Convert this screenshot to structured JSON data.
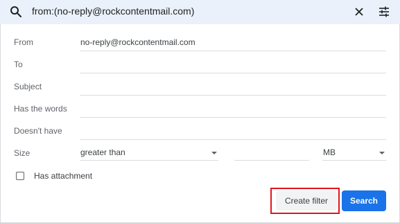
{
  "search": {
    "query": "from:(no-reply@rockcontentmail.com)"
  },
  "icons": {
    "search": "search-icon",
    "close": "close-icon",
    "options": "tune-icon"
  },
  "fields": [
    {
      "label": "From",
      "value": "no-reply@rockcontentmail.com"
    },
    {
      "label": "To",
      "value": ""
    },
    {
      "label": "Subject",
      "value": ""
    },
    {
      "label": "Has the words",
      "value": ""
    },
    {
      "label": "Doesn't have",
      "value": ""
    }
  ],
  "size": {
    "label": "Size",
    "comparator": "greater than",
    "amount": "",
    "unit": "MB"
  },
  "attachment": {
    "label": "Has attachment",
    "checked": false
  },
  "buttons": {
    "create_filter": "Create filter",
    "search": "Search"
  },
  "colors": {
    "search_bar_bg": "#eaf1fb",
    "primary_button": "#1a73e8",
    "highlight_box": "#e0141e"
  }
}
